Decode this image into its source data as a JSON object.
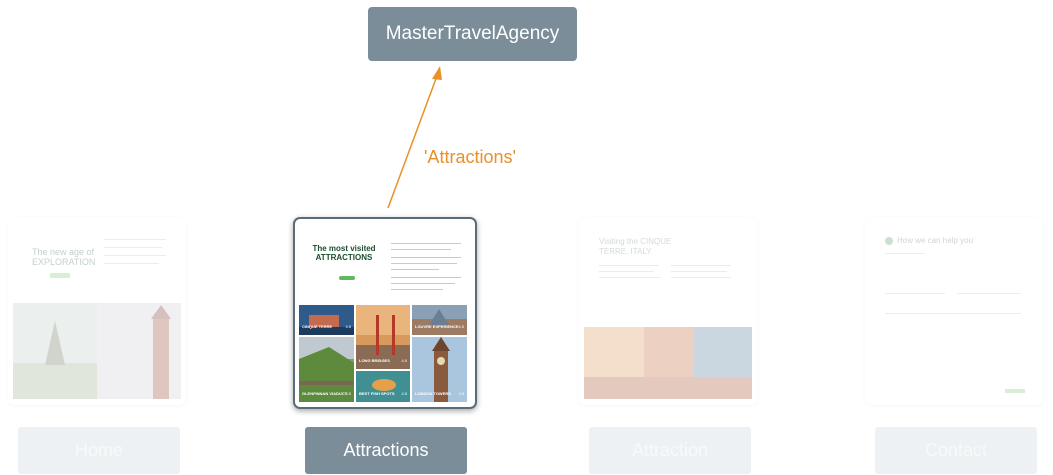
{
  "root": {
    "label": "MasterTravelAgency"
  },
  "edge": {
    "label": "'Attractions'"
  },
  "colors": {
    "node": "#7a8d99",
    "edge": "#e8902a"
  },
  "pages": [
    {
      "tab": "Home",
      "active": false
    },
    {
      "tab": "Attractions",
      "active": true
    },
    {
      "tab": "Attraction",
      "active": false
    },
    {
      "tab": "Contact",
      "active": false
    }
  ],
  "attractions_card": {
    "title": "The most visited ATTRACTIONS",
    "tiles": [
      {
        "name": "CINQUE TERRE",
        "rating": "4.5"
      },
      {
        "name": "LONG BRIDGES",
        "rating": "4.5"
      },
      {
        "name": "LOUVRE EXPERIENCE",
        "rating": "4.5"
      },
      {
        "name": "GLENFINNAN VIADUCT",
        "rating": "4.5"
      },
      {
        "name": "BEST FISH SPOTS",
        "rating": "4.5"
      },
      {
        "name": "LONDON TOWERS",
        "rating": "4.5"
      }
    ]
  },
  "home_card": {
    "title": "The new age of EXPLORATION"
  },
  "attraction_card": {
    "title": "Visiting the CINQUE TERRE, ITALY"
  },
  "contact_card": {
    "title": "How we can help you"
  }
}
